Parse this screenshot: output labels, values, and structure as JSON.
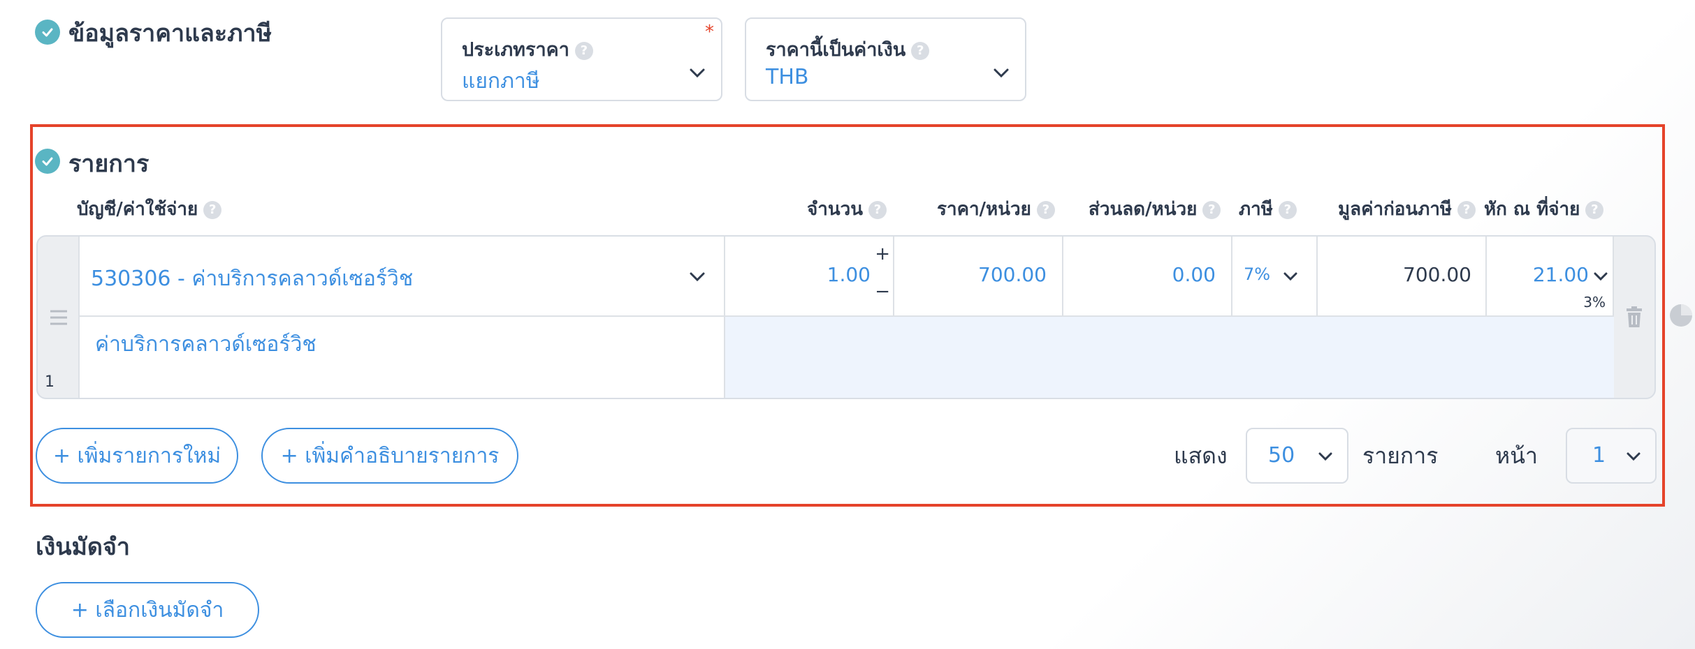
{
  "price_tax": {
    "title": "ข้อมูลราคาและภาษี",
    "price_type": {
      "label": "ประเภทราคา",
      "required_mark": "*",
      "value": "แยกภาษี"
    },
    "currency": {
      "label": "ราคานี้เป็นค่าเงิน",
      "value": "THB"
    }
  },
  "items": {
    "title": "รายการ",
    "columns": {
      "account": "บัญชี/ค่าใช้จ่าย",
      "qty": "จำนวน",
      "unit_price": "ราคา/หน่วย",
      "discount": "ส่วนลด/หน่วย",
      "tax": "ภาษี",
      "pretax": "มูลค่าก่อนภาษี",
      "wht": "หัก ณ ที่จ่าย"
    },
    "row": {
      "index": "1",
      "account": "530306 - ค่าบริการคลาวด์เซอร์วิช",
      "description": "ค่าบริการคลาวด์เซอร์วิช",
      "qty": "1.00",
      "plus": "+",
      "minus": "−",
      "unit_price": "700.00",
      "discount": "0.00",
      "tax": "7%",
      "pretax": "700.00",
      "wht": "21.00",
      "wht_rate": "3%"
    },
    "add_item_button": "+ เพิ่มรายการใหม่",
    "add_desc_button": "+ เพิ่มคำอธิบายรายการ",
    "pager": {
      "show_label": "แสดง",
      "per_page": "50",
      "items_label": "รายการ",
      "page_label": "หน้า",
      "page": "1"
    }
  },
  "deposit": {
    "title": "เงินมัดจำ",
    "select_button": "+ เลือกเงินมัดจำ"
  },
  "colors": {
    "accent": "#3d8fe0",
    "check": "#5ab5c3",
    "highlight_border": "#e5432a",
    "required": "#e5432a"
  },
  "icons": [
    "check-icon",
    "help-icon",
    "chevron-down-icon",
    "drag-handle-icon",
    "trash-icon",
    "pie-icon"
  ]
}
